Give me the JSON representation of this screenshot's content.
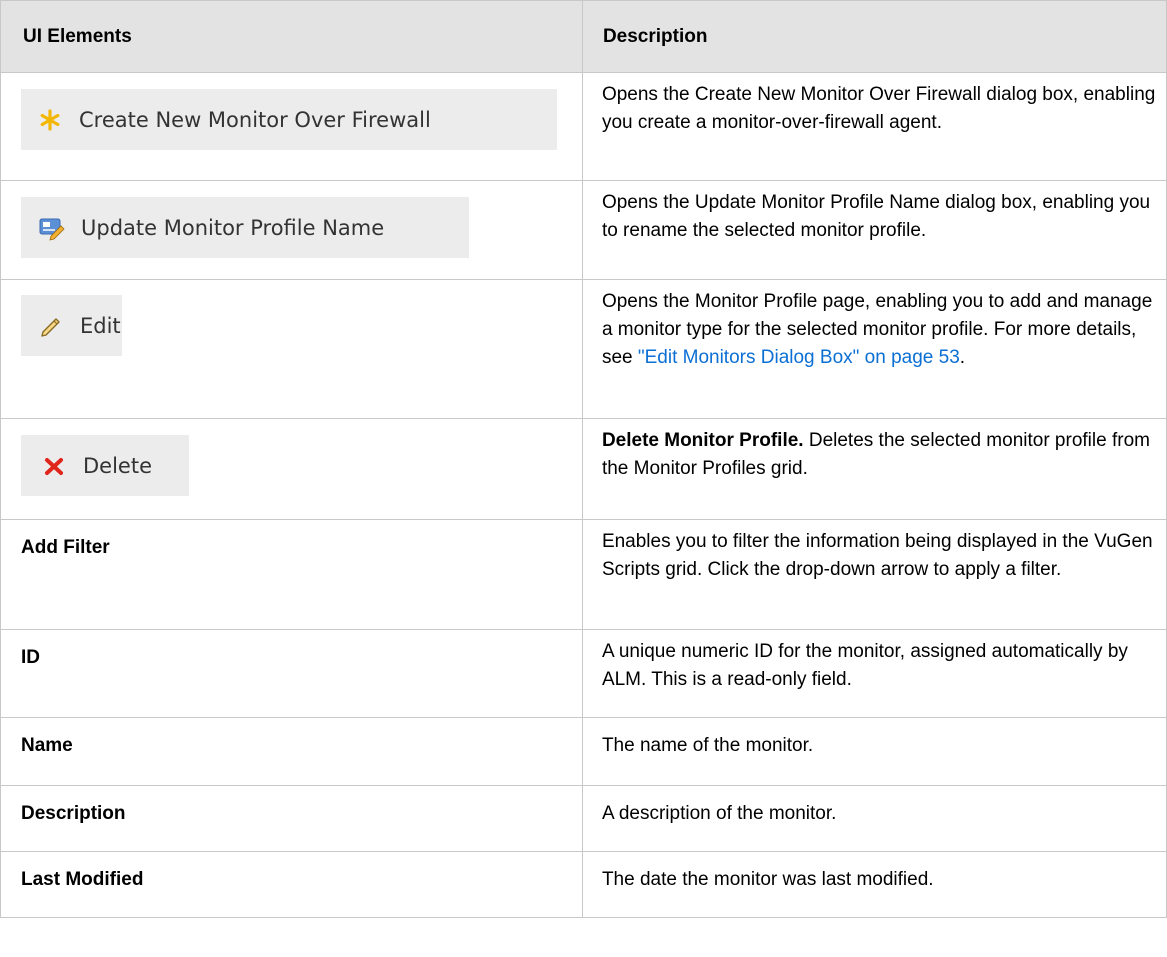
{
  "headers": {
    "col1": "UI Elements",
    "col2": "Description"
  },
  "rows": [
    {
      "element": "Create New Monitor Over Firewall",
      "icon": "asterisk-icon",
      "description": "Opens the Create New Monitor Over Firewall dialog box, enabling you create a monitor-over-firewall agent."
    },
    {
      "element": "Update Monitor Profile Name",
      "icon": "rename-card-icon",
      "description": "Opens the Update Monitor Profile Name dialog box, enabling you to rename the selected monitor profile."
    },
    {
      "element": "Edit",
      "icon": "pencil-icon",
      "description_before": "Opens the Monitor Profile page, enabling you to add and manage a monitor type for the selected monitor profile. For more details, see ",
      "link": "\"Edit Monitors Dialog Box\" on page 53",
      "description_after": "."
    },
    {
      "element": "Delete",
      "icon": "delete-x-icon",
      "description_bold": "Delete Monitor Profile.",
      "description": " Deletes the selected monitor profile from the Monitor Profiles grid."
    },
    {
      "element": "Add Filter",
      "description": "Enables you to filter the information being displayed in the VuGen Scripts grid. Click the drop-down arrow to apply a filter."
    },
    {
      "element": "ID",
      "description": "A unique numeric ID for the monitor, assigned automatically by ALM. This is a read-only field."
    },
    {
      "element": "Name",
      "description": "The name of the monitor."
    },
    {
      "element": "Description",
      "description": "A description of the monitor."
    },
    {
      "element": "Last Modified",
      "description": "The date the monitor was last modified."
    }
  ],
  "colors": {
    "header_bg": "#e3e3e3",
    "button_bg": "#ececec",
    "link": "#0b6fd4",
    "border": "#c8c8c8"
  }
}
